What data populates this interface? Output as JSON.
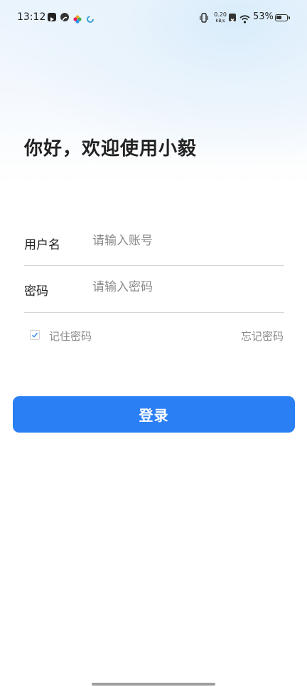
{
  "status_bar": {
    "time": "13:12",
    "net_speed_value": "0.20",
    "net_speed_unit": "KB/s",
    "battery": "53%",
    "battery_level": 0.53
  },
  "header": {
    "title": "你好，欢迎使用小毅"
  },
  "form": {
    "username_label": "用户名",
    "username_placeholder": "请输入账号",
    "password_label": "密码",
    "password_placeholder": "请输入密码",
    "remember_label": "记住密码",
    "remember_checked": true,
    "forgot_label": "忘记密码"
  },
  "login_button": "登录",
  "colors": {
    "accent": "#2a7ff5"
  }
}
